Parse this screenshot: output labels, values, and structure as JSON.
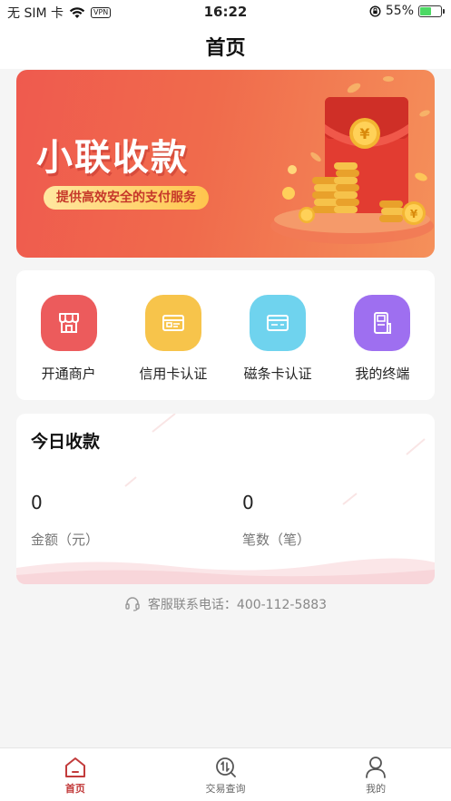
{
  "status_bar": {
    "carrier": "无 SIM 卡",
    "vpn": "VPN",
    "time": "16:22",
    "battery": "55%",
    "battery_level": 0.55
  },
  "nav": {
    "title": "首页"
  },
  "banner": {
    "title": "小联收款",
    "subtitle": "提供高效安全的支付服务",
    "currency_symbol": "¥"
  },
  "menu": {
    "items": [
      {
        "label": "开通商户",
        "icon": "storefront-icon",
        "color": "#ec5b5c"
      },
      {
        "label": "信用卡认证",
        "icon": "credit-card-icon",
        "color": "#f7c44b"
      },
      {
        "label": "磁条卡认证",
        "icon": "magnetic-card-icon",
        "color": "#6fd3ee"
      },
      {
        "label": "我的终端",
        "icon": "pos-terminal-icon",
        "color": "#9e6ff0"
      }
    ]
  },
  "today": {
    "title": "今日收款",
    "amount_value": "0",
    "amount_label": "金额（元）",
    "count_value": "0",
    "count_label": "笔数（笔）"
  },
  "hotline": {
    "text": "客服联系电话：400-112-5883",
    "icon": "headset-icon"
  },
  "tabs": [
    {
      "label": "首页",
      "icon": "home-icon",
      "active": true
    },
    {
      "label": "交易查询",
      "icon": "transaction-search-icon",
      "active": false
    },
    {
      "label": "我的",
      "icon": "user-icon",
      "active": false
    }
  ],
  "colors": {
    "accent": "#c23b3b",
    "banner_start": "#ef5a4e",
    "banner_end": "#f5905a"
  }
}
